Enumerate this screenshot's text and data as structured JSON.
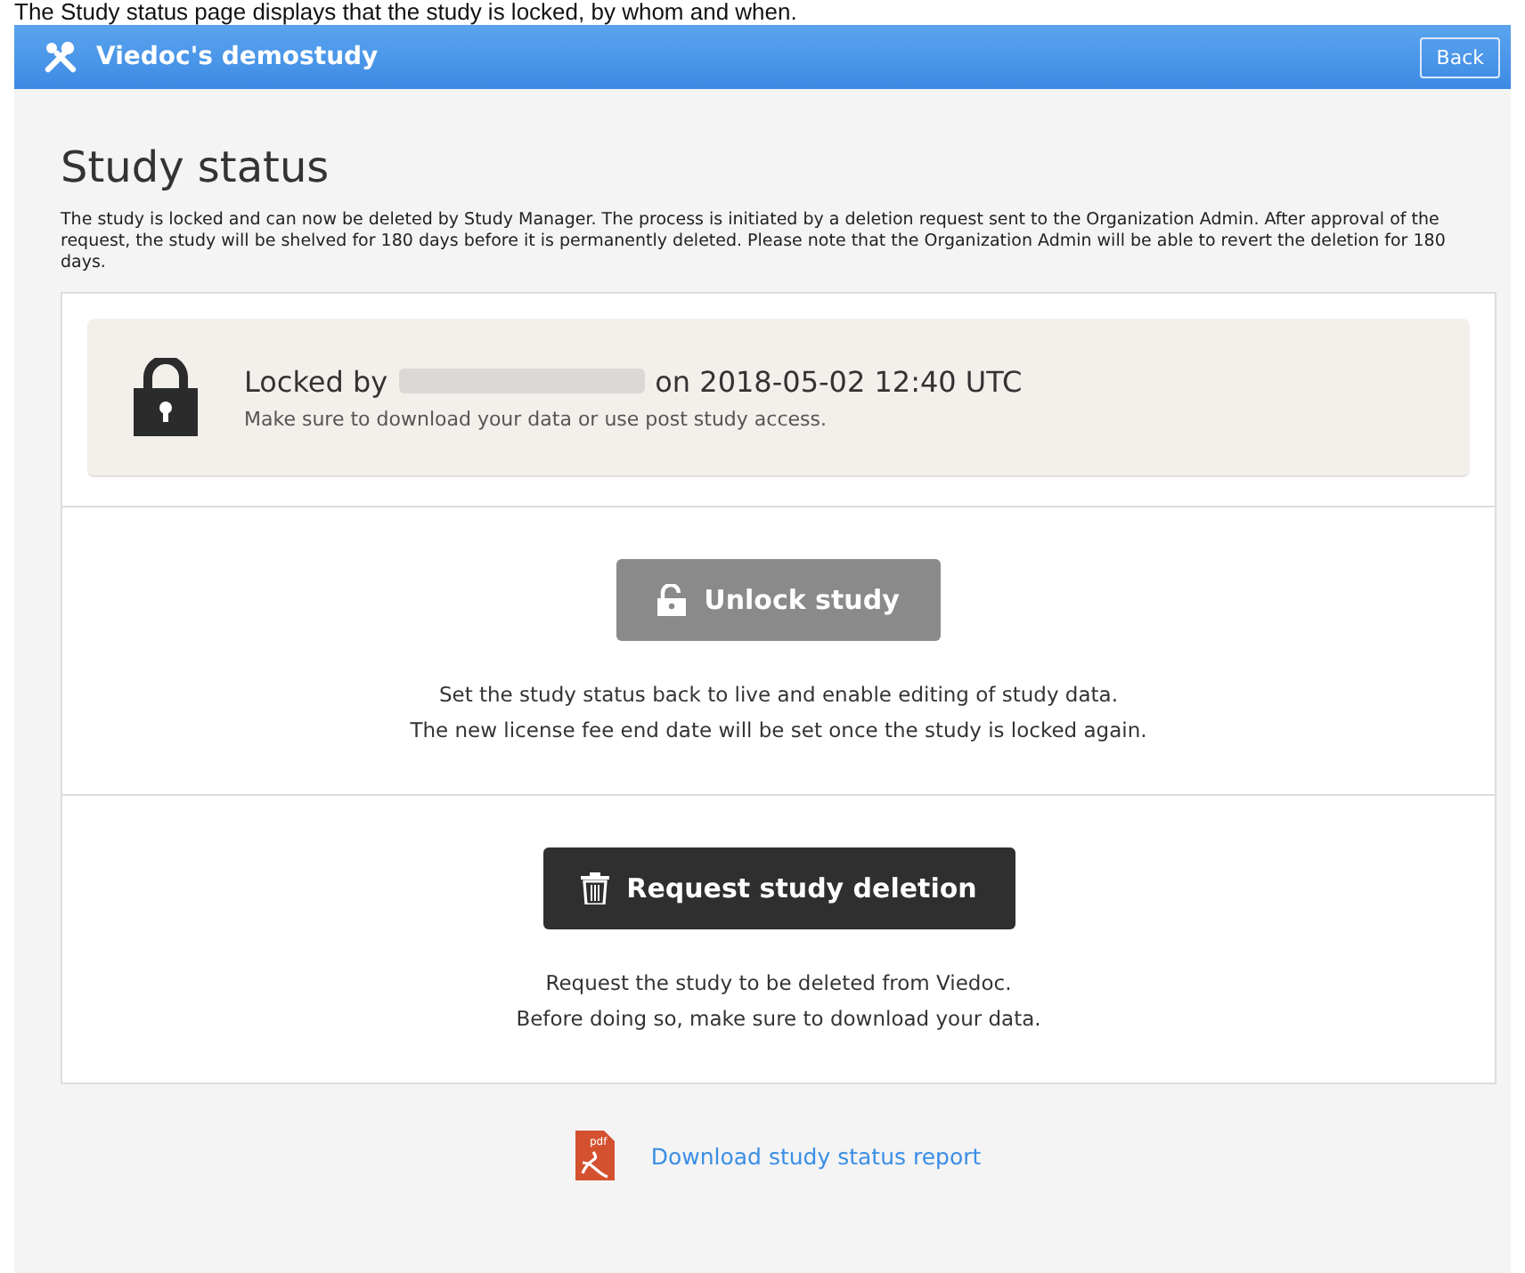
{
  "caption": "The Study status page displays that the study is locked, by whom and when.",
  "header": {
    "title": "Viedoc's demostudy",
    "back_button": "Back"
  },
  "page_title": "Study status",
  "intro": "The study is locked and can now be deleted by Study Manager. The process is initiated by a deletion request sent to the Organization Admin. After approval of the request, the study will be shelved for 180 days before it is permanently deleted. Please note that the Organization Admin will be able to revert the deletion for 180 days.",
  "lock_notice": {
    "prefix": "Locked by",
    "suffix": "on 2018-05-02 12:40 UTC",
    "note": "Make sure to download your data or use post study access."
  },
  "actions": [
    {
      "kind": "unlock",
      "label": "Unlock study",
      "lines": [
        "Set the study status back to live and enable editing of study data.",
        "The new license fee end date will be set once the study is locked again."
      ]
    },
    {
      "kind": "delete",
      "label": "Request study deletion",
      "lines": [
        "Request the study to be deleted from Viedoc.",
        "Before doing so, make sure to download your data."
      ]
    }
  ],
  "download": {
    "icon_label": "pdf",
    "link": "Download study status report"
  }
}
